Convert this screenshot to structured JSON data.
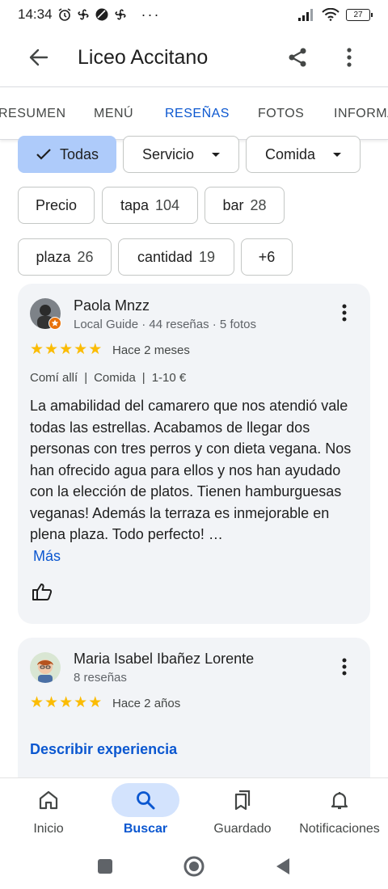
{
  "status_bar": {
    "time": "14:34",
    "battery": "27",
    "overflow": "···"
  },
  "header": {
    "title": "Liceo Accitano"
  },
  "tabs": [
    {
      "label": "RESUMEN"
    },
    {
      "label": "MENÚ"
    },
    {
      "label": "RESEÑAS"
    },
    {
      "label": "FOTOS"
    },
    {
      "label": "INFORMA"
    }
  ],
  "filters": {
    "row1": [
      {
        "label": "Todas",
        "selected": true
      },
      {
        "label": "Servicio"
      },
      {
        "label": "Comida"
      }
    ],
    "row2": [
      {
        "label": "Precio"
      },
      {
        "label": "tapa",
        "count": "104"
      },
      {
        "label": "bar",
        "count": "28"
      }
    ],
    "row3": [
      {
        "label": "plaza",
        "count": "26"
      },
      {
        "label": "cantidad",
        "count": "19"
      },
      {
        "label": "+6"
      }
    ]
  },
  "reviews": [
    {
      "author": "Paola Mnzz",
      "meta": "Local Guide · 44 reseñas · 5 fotos",
      "rating": 5,
      "when": "Hace 2 meses",
      "attrs": [
        "Comí allí",
        "Comida",
        "1-10 €"
      ],
      "attr_sep": "|",
      "text": "La amabilidad del camarero que nos atendió vale todas las estrellas. Acabamos de llegar dos personas con tres perros y con dieta vegana. Nos han ofrecido agua para ellos y nos han ayudado con la elección de platos. Tienen hamburguesas veganas! Además la terraza es inmejorable en plena plaza. Todo perfecto! …",
      "more": "Más"
    },
    {
      "author": "Maria Isabel Ibañez Lorente",
      "meta": "8 reseñas",
      "rating": 5,
      "when": "Hace 2 años",
      "action": "Describir experiencia"
    }
  ],
  "bottom_nav": [
    {
      "label": "Inicio",
      "icon": "home-icon"
    },
    {
      "label": "Buscar",
      "icon": "search-icon",
      "active": true
    },
    {
      "label": "Guardado",
      "icon": "bookmarks-icon"
    },
    {
      "label": "Notificaciones",
      "icon": "bell-icon"
    }
  ],
  "colors": {
    "accent": "#0b57d0",
    "chip_selected": "#aecbfa",
    "star": "#fbbc04",
    "card_bg": "#f2f4f7",
    "nav_active_pill": "#d3e3fd"
  }
}
